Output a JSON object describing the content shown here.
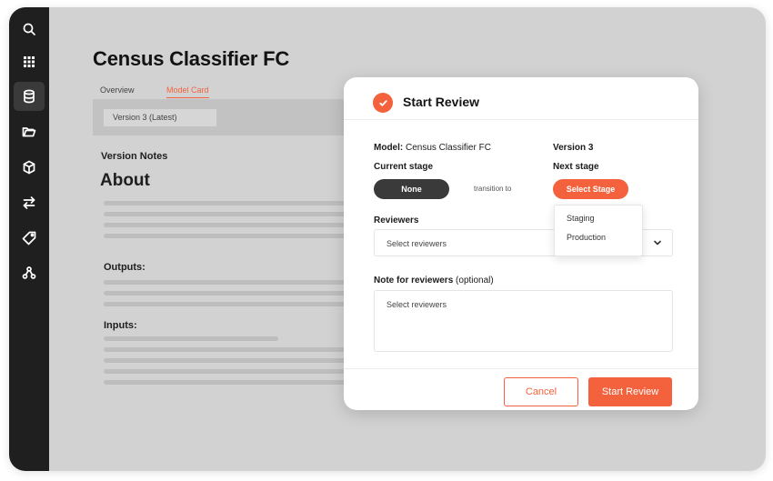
{
  "sidebar": {
    "items": [
      {
        "icon": "search-icon"
      },
      {
        "icon": "grid-icon"
      },
      {
        "icon": "database-icon",
        "active": true
      },
      {
        "icon": "folder-icon"
      },
      {
        "icon": "cube-icon"
      },
      {
        "icon": "transfer-icon"
      },
      {
        "icon": "tag-icon"
      },
      {
        "icon": "network-icon"
      }
    ]
  },
  "page": {
    "title": "Census Classifier FC",
    "tabs": [
      {
        "label": "Overview"
      },
      {
        "label": "Model Card",
        "active": true
      }
    ],
    "version_select": "Version 3 (Latest)",
    "version_notes": "Version Notes",
    "about": "About",
    "outputs": "Outputs:",
    "inputs": "Inputs:"
  },
  "modal": {
    "title": "Start Review",
    "model_label": "Model:",
    "model_value": "Census Classifier FC",
    "version": "Version 3",
    "current_stage_label": "Current stage",
    "current_stage_value": "None",
    "transition_text": "transition to",
    "next_stage_label": "Next stage",
    "next_stage_button": "Select Stage",
    "stage_options": [
      "Staging",
      "Production"
    ],
    "reviewers_label": "Reviewers",
    "reviewers_placeholder": "Select reviewers",
    "note_label": "Note for reviewers",
    "note_optional": "(optional)",
    "note_placeholder": "Select reviewers",
    "cancel_label": "Cancel",
    "start_label": "Start Review"
  },
  "colors": {
    "accent": "#f3623c",
    "sidebar": "#1f1f1f",
    "overlay": "#d2d2d2"
  }
}
